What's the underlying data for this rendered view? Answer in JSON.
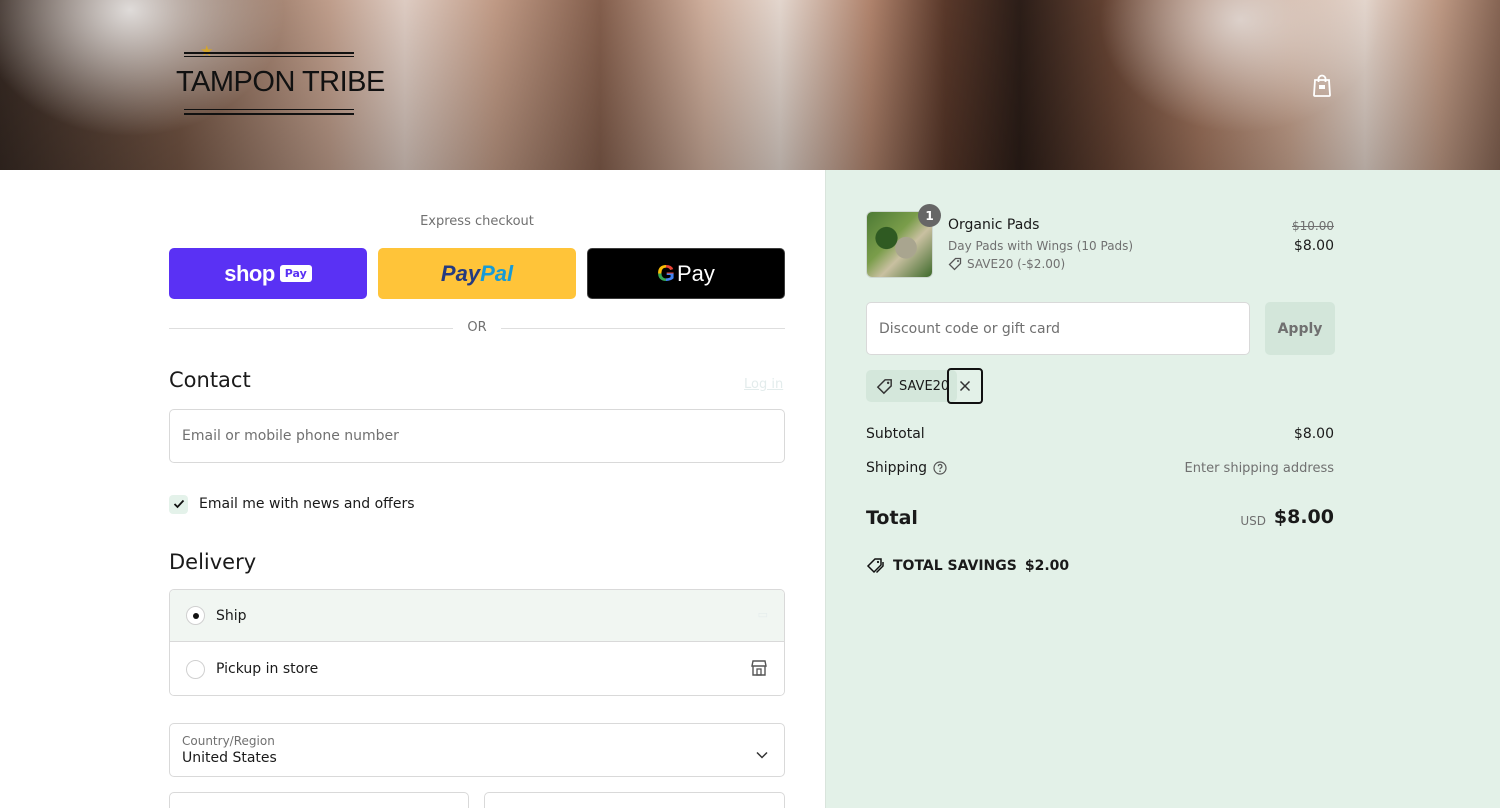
{
  "brand": {
    "logo_text": "TAMPON TRIBE",
    "accent": "#d4a52a"
  },
  "header": {
    "bag_icon": "shopping-bag-icon"
  },
  "express": {
    "label": "Express checkout",
    "shop_pay_brand": "shop",
    "shop_pay_tag": "Pay",
    "paypal_part1": "Pay",
    "paypal_part2": "Pal",
    "gpay_g": "G",
    "gpay_text": "Pay",
    "or_label": "OR"
  },
  "contact": {
    "title": "Contact",
    "login_link": "Log in",
    "email_placeholder": "Email or mobile phone number",
    "news_checkbox_label": "Email me with news and offers",
    "news_checked": true
  },
  "delivery": {
    "title": "Delivery",
    "options": [
      {
        "label": "Ship",
        "selected": true
      },
      {
        "label": "Pickup in store",
        "selected": false
      }
    ],
    "country_label": "Country/Region",
    "country_value": "United States"
  },
  "order": {
    "item": {
      "quantity": "1",
      "name": "Organic Pads",
      "variant": "Day Pads with Wings (10 Pads)",
      "discount": "SAVE20 (-$2.00)",
      "original_price": "$10.00",
      "price": "$8.00"
    },
    "discount_placeholder": "Discount code or gift card",
    "apply_label": "Apply",
    "applied_code": "SAVE20",
    "subtotal_label": "Subtotal",
    "subtotal_value": "$8.00",
    "shipping_label": "Shipping",
    "shipping_value": "Enter shipping address",
    "total_label": "Total",
    "currency": "USD",
    "total_value": "$8.00",
    "savings_label": "TOTAL SAVINGS",
    "savings_value": "$2.00"
  },
  "colors": {
    "shop_pay": "#5a31f4",
    "paypal": "#ffc439",
    "gpay": "#000000",
    "summary_bg": "#e3f1e8"
  }
}
